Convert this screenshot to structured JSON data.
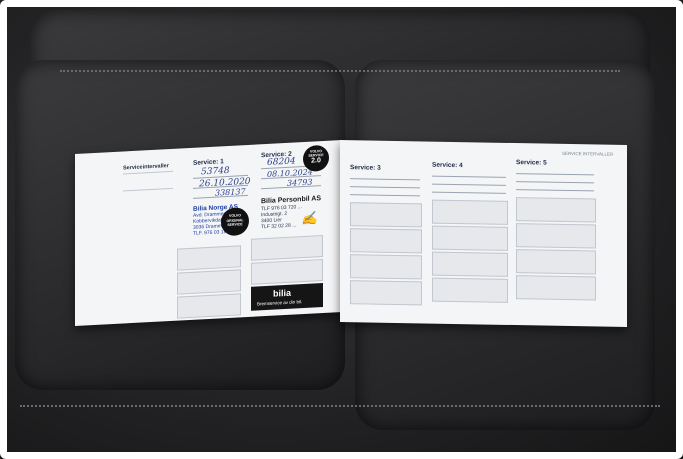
{
  "left_page": {
    "header": "",
    "section_title": "Serviceintervaller",
    "col1_title": "Serviceinterval",
    "col2_title": "Service: 1",
    "col3_title": "Service: 2",
    "service1": {
      "km": "53748",
      "date": "26.10.2020",
      "order": "338137"
    },
    "service2": {
      "km": "68204",
      "date": "08.10.2024",
      "order": "34793"
    },
    "stamp_left_name": "Bilia Norge AS",
    "stamp_left_lines": [
      "Avd. Drammen",
      "Kobbervikdalen",
      "3036 Drammen",
      "TLF. 976 03 189"
    ],
    "stamp_right_name": "Bilia Personbil AS",
    "stamp_right_lines": [
      "TLF 976 03 720 ...",
      "Industrigt. 2",
      "3400 Lier",
      "TLF 32 02 28 ..."
    ],
    "seal_left": [
      "VOLVO",
      "ORIGINAL",
      "SERVICE"
    ],
    "seal_right": [
      "VOLVO",
      "SERVICE",
      "2.0"
    ],
    "bilia_logo": "bilia",
    "bilia_tagline": "Bremservice av din bil."
  },
  "right_page": {
    "header": "SERVICE INTERVALLER",
    "service3": "Service: 3",
    "service4": "Service: 4",
    "service5": "Service: 5"
  }
}
